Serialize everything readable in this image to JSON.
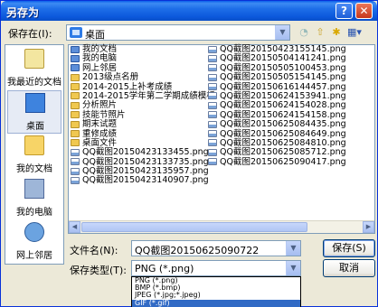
{
  "window": {
    "title": "另存为",
    "help_glyph": "?",
    "close_glyph": "✕"
  },
  "save_in": {
    "label": "保存在(I):",
    "value": "桌面"
  },
  "toolbar": {
    "back_glyph": "◔",
    "up_glyph": "⇧",
    "newfolder_glyph": "✱",
    "views_glyph": "▦▾"
  },
  "places": [
    {
      "label": "我最近的文档",
      "icon": "recent-documents-icon"
    },
    {
      "label": "桌面",
      "icon": "desktop-icon",
      "selected": true
    },
    {
      "label": "我的文档",
      "icon": "my-documents-icon"
    },
    {
      "label": "我的电脑",
      "icon": "my-computer-icon"
    },
    {
      "label": "网上邻居",
      "icon": "network-places-icon"
    }
  ],
  "files_col1": [
    {
      "name": "我的文档",
      "type": "sys"
    },
    {
      "name": "我的电脑",
      "type": "sys"
    },
    {
      "name": "网上邻居",
      "type": "sys"
    },
    {
      "name": "2013级点名册",
      "type": "folder"
    },
    {
      "name": "2014-2015上补考成绩",
      "type": "folder"
    },
    {
      "name": "2014-2015学年第二学期成绩模板",
      "type": "folder"
    },
    {
      "name": "分析照片",
      "type": "folder"
    },
    {
      "name": "技能节照片",
      "type": "folder"
    },
    {
      "name": "期末试题",
      "type": "folder"
    },
    {
      "name": "重修成绩",
      "type": "folder"
    },
    {
      "name": "桌面文件",
      "type": "folder"
    },
    {
      "name": "QQ截图20150423133455.png",
      "type": "image"
    },
    {
      "name": "QQ截图20150423133735.png",
      "type": "image"
    },
    {
      "name": "QQ截图20150423135957.png",
      "type": "image"
    },
    {
      "name": "QQ截图20150423140907.png",
      "type": "image"
    }
  ],
  "files_col2": [
    {
      "name": "QQ截图20150423155145.png",
      "type": "image"
    },
    {
      "name": "QQ截图20150504141241.png",
      "type": "image"
    },
    {
      "name": "QQ截图20150505100453.png",
      "type": "image"
    },
    {
      "name": "QQ截图20150505154145.png",
      "type": "image"
    },
    {
      "name": "QQ截图20150616144457.png",
      "type": "image"
    },
    {
      "name": "QQ截图20150624153941.png",
      "type": "image"
    },
    {
      "name": "QQ截图20150624154028.png",
      "type": "image"
    },
    {
      "name": "QQ截图20150624154158.png",
      "type": "image"
    },
    {
      "name": "QQ截图20150625084435.png",
      "type": "image"
    },
    {
      "name": "QQ截图20150625084649.png",
      "type": "image"
    },
    {
      "name": "QQ截图20150625084810.png",
      "type": "image"
    },
    {
      "name": "QQ截图20150625085712.png",
      "type": "image"
    },
    {
      "name": "QQ截图20150625090417.png",
      "type": "image"
    }
  ],
  "file_name": {
    "label": "文件名(N):",
    "value": "QQ截图20150625090722"
  },
  "file_type": {
    "label": "保存类型(T):",
    "value": "PNG (*.png)"
  },
  "buttons": {
    "save": "保存(S)",
    "cancel": "取消"
  },
  "type_options": [
    {
      "label": "PNG (*.png)",
      "selected": false
    },
    {
      "label": "BMP (*.bmp)",
      "selected": false
    },
    {
      "label": "JPEG (*.jpg;*.jpeg)",
      "selected": false
    },
    {
      "label": "GIF (*.gif)",
      "selected": true
    }
  ],
  "colors": {
    "title_bar": "#0A5FEA",
    "selection": "#316AC5",
    "dialog_bg": "#ECE9D8"
  }
}
